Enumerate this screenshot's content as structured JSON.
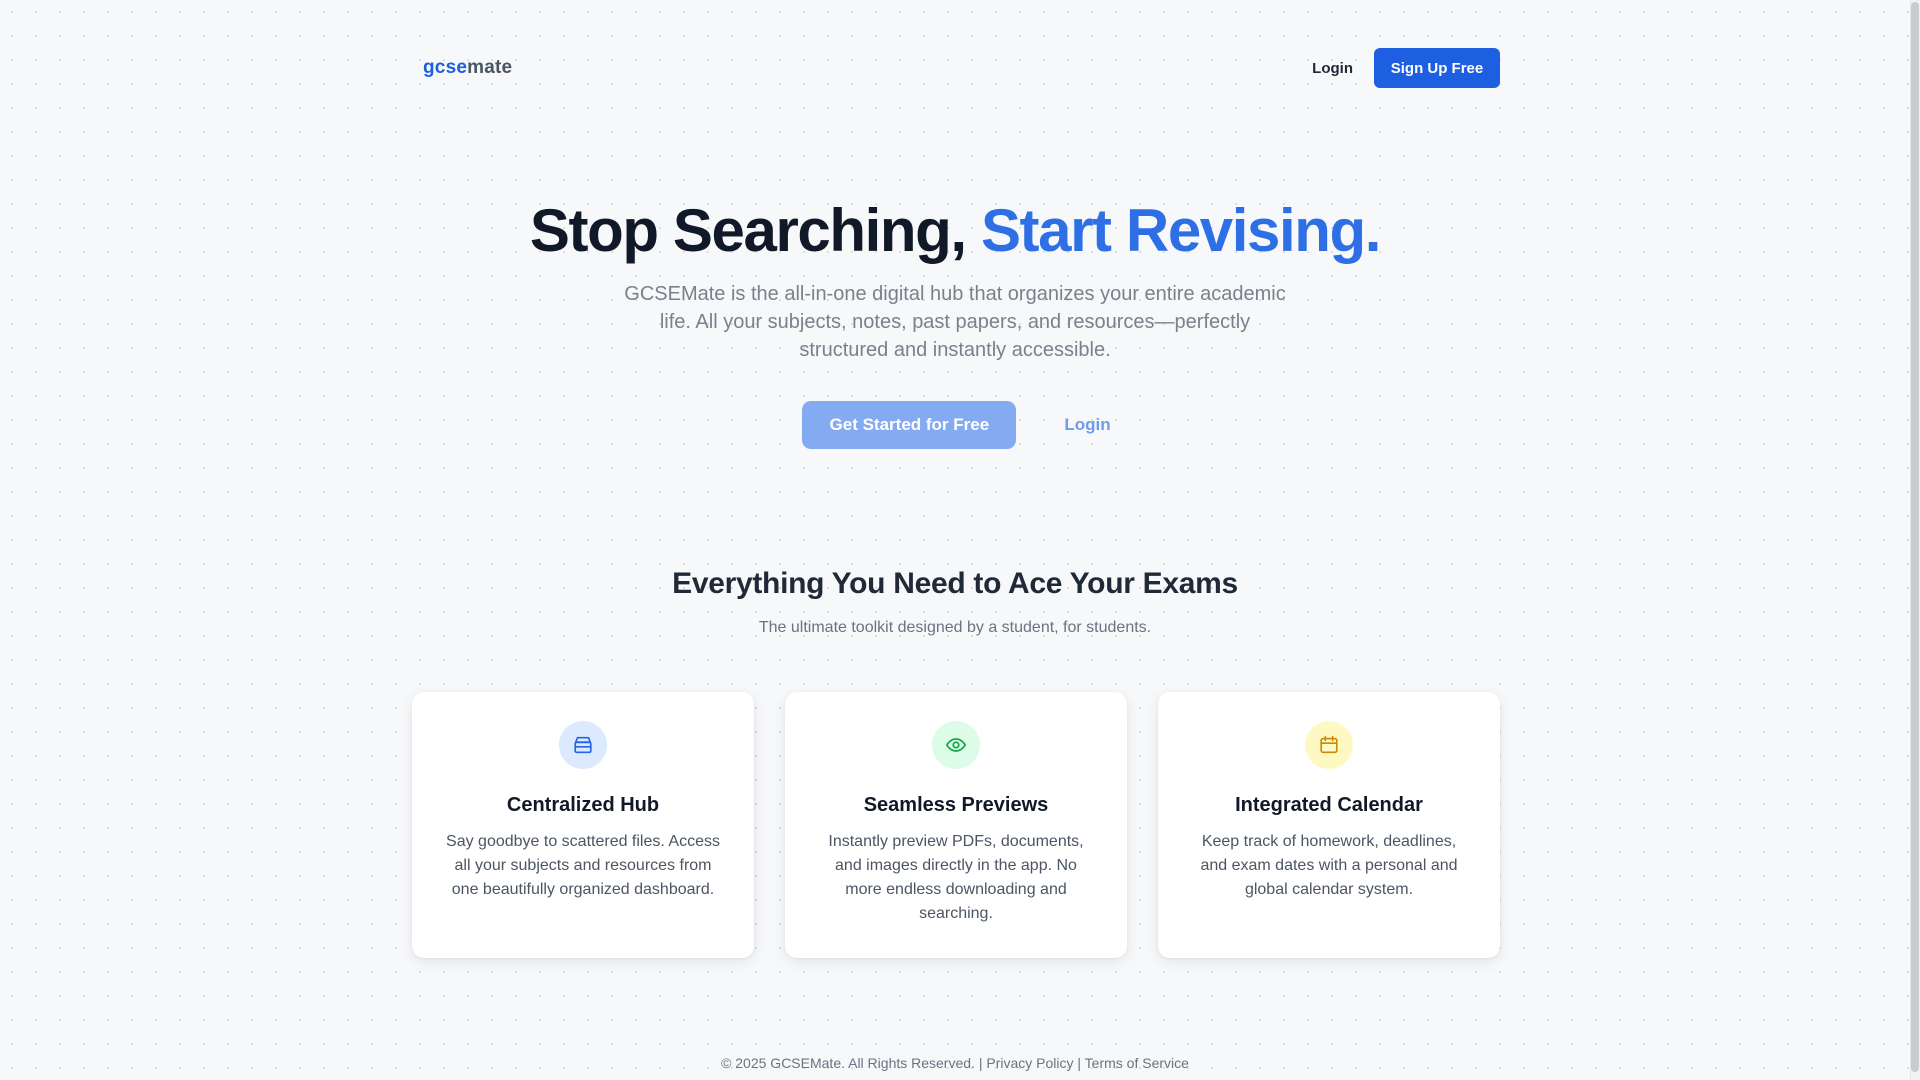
{
  "header": {
    "logo_part1": "gcse",
    "logo_part2": "mate",
    "login_label": "Login",
    "signup_label": "Sign Up Free"
  },
  "hero": {
    "title_main": "Stop Searching, ",
    "title_accent": "Start Revising.",
    "subtitle": "GCSEMate is the all-in-one digital hub that organizes your entire academic life. All your subjects, notes, past papers, and resources—perfectly structured and instantly accessible.",
    "cta_primary": "Get Started for Free",
    "cta_secondary": "Login"
  },
  "features": {
    "title": "Everything You Need to Ace Your Exams",
    "subtitle": "The ultimate toolkit designed by a student, for students.",
    "cards": [
      {
        "icon": "archive-box-icon",
        "title": "Centralized Hub",
        "description": "Say goodbye to scattered files. Access all your subjects and resources from one beautifully organized dashboard."
      },
      {
        "icon": "eye-icon",
        "title": "Seamless Previews",
        "description": "Instantly preview PDFs, documents, and images directly in the app. No more endless downloading and searching."
      },
      {
        "icon": "calendar-icon",
        "title": "Integrated Calendar",
        "description": "Keep track of homework, deadlines, and exam dates with a personal and global calendar system."
      }
    ]
  },
  "footer": {
    "copyright": "© 2025 GCSEMate. All Rights Reserved.",
    "separator": " | ",
    "privacy": "Privacy Policy",
    "terms": "Terms of Service"
  },
  "colors": {
    "brand_blue": "#1d5fe0",
    "accent_blue": "#2f6fe6",
    "icon_blue_bg": "#dbeafe",
    "icon_green_bg": "#dcfce7",
    "icon_yellow_bg": "#fef9c3"
  }
}
